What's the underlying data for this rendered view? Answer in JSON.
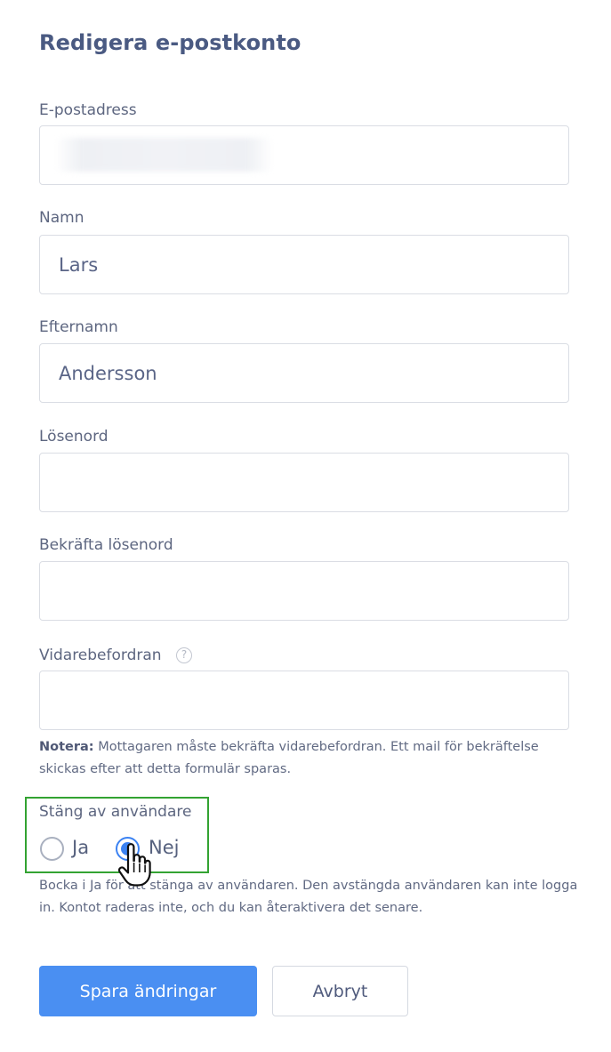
{
  "page": {
    "title": "Redigera e-postkonto"
  },
  "form": {
    "email": {
      "label": "E-postadress",
      "value": ""
    },
    "first_name": {
      "label": "Namn",
      "value": "Lars"
    },
    "last_name": {
      "label": "Efternamn",
      "value": "Andersson"
    },
    "password": {
      "label": "Lösenord",
      "value": ""
    },
    "confirm_password": {
      "label": "Bekräfta lösenord",
      "value": ""
    },
    "forwarding": {
      "label": "Vidarebefordran",
      "help_icon": "question-circle-icon",
      "help_glyph": "?",
      "value": "",
      "note_prefix": "Notera:",
      "note_text": " Mottagaren måste bekräfta vidarebefordran. Ett mail för bekräftelse skickas efter att detta formulär sparas."
    },
    "deactivate": {
      "label": "Stäng av användare",
      "options": [
        {
          "label": "Ja",
          "selected": false
        },
        {
          "label": "Nej",
          "selected": true
        }
      ],
      "help_text": "Bocka i Ja för att stänga av användaren. Den avstängda användaren kan inte logga in. Kontot raderas inte, och du kan återaktivera det senare.",
      "highlight_color": "#33a332"
    }
  },
  "actions": {
    "save_label": "Spara ändringar",
    "cancel_label": "Avbryt"
  },
  "colors": {
    "primary": "#4a8ff2",
    "radio_selected": "#3b82f2",
    "title": "#4a5a82"
  },
  "cursor": {
    "icon": "hand-pointer-cursor-icon"
  }
}
